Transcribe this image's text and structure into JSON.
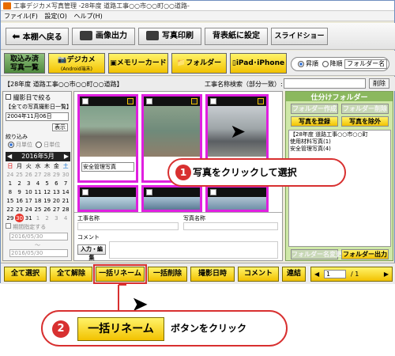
{
  "window": {
    "title": "工事デジカメ写真管理 -28年度 道路工事○○市○○町○○道路-",
    "menu": [
      "ファイル(F)",
      "設定(O)",
      "ヘルプ(H)"
    ]
  },
  "toolbar": {
    "back": "本棚へ戻る",
    "image_out": "画像出力",
    "print": "写真印刷",
    "wallpaper": "背表紙に設定",
    "slideshow": "スライドショー"
  },
  "mode_tabs": {
    "imported_l1": "取込み済",
    "imported_l2": "写真一覧",
    "digicam": "デジカメ",
    "digicam_sub": "(Android端末)",
    "memory_card": "メモリーカード",
    "folder": "フォルダー",
    "ipad": "iPad･iPhone"
  },
  "sort": {
    "asc": "昇順",
    "desc": "降順",
    "field": "フォルダー名"
  },
  "path_label": "【28年度 道路工事○○市○○町○○道路】",
  "search": {
    "label": "工事名称検索（部分一致）:",
    "value": "",
    "clear": "削除"
  },
  "left_filter": {
    "by_date": "撮影日で絞る",
    "all_dates": "【全ての写真撮影日一覧】",
    "date_value": "2004年11月06日",
    "show": "表示",
    "narrow": "絞り込み",
    "by_month": "月単位",
    "by_day": "日単位",
    "calendar_title": "2016年5月",
    "weekdays": [
      "日",
      "月",
      "火",
      "水",
      "木",
      "金",
      "土"
    ],
    "weeks": [
      [
        "24",
        "25",
        "26",
        "27",
        "28",
        "29",
        "30"
      ],
      [
        "1",
        "2",
        "3",
        "4",
        "5",
        "6",
        "7"
      ],
      [
        "8",
        "9",
        "10",
        "11",
        "12",
        "13",
        "14"
      ],
      [
        "15",
        "16",
        "17",
        "18",
        "19",
        "20",
        "21"
      ],
      [
        "22",
        "23",
        "24",
        "25",
        "26",
        "27",
        "28"
      ],
      [
        "29",
        "30",
        "31",
        "1",
        "2",
        "3",
        "4"
      ]
    ],
    "period": "期間指定する",
    "from": "2016/05/30",
    "to": "2016/05/30",
    "tilde": "～"
  },
  "thumbs": {
    "caption1": "安全管理写真"
  },
  "details": {
    "work_name": "工事名称",
    "photo_name": "写真名称",
    "comment": "コメント",
    "input_edit": "入力・編集"
  },
  "right_panel": {
    "title": "仕分けフォルダー",
    "create": "フォルダー作成",
    "delete": "フォルダー削除",
    "register": "写真を登録",
    "remove": "写真を除外",
    "folders": [
      "【28年度 道路工事○○市○○町",
      "使用材料写真(1)",
      "安全管理写真(4)"
    ],
    "rename": "フォルダー名変更",
    "export": "フォルダー出力"
  },
  "bottom": {
    "select_all": "全て選択",
    "deselect_all": "全て解除",
    "rename_all": "一括リネーム",
    "delete_all": "一括削除",
    "shoot_date": "撮影日時",
    "comment": "コメント",
    "sequence": "連結",
    "page": "1",
    "page_total": "/ 1"
  },
  "callouts": {
    "step1_num": "1",
    "step1_text": "写真をクリックして選択",
    "step2_num": "2",
    "step2_btn": "一括リネーム",
    "step2_text": "ボタンをクリック"
  },
  "colors": {
    "selection_border": "#e020e0",
    "accent_yellow": "#f2c200",
    "callout_red": "#d83030",
    "panel_green": "#cfe8a8"
  }
}
